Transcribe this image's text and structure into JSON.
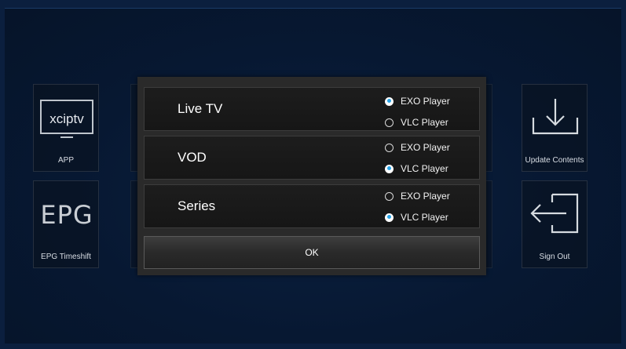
{
  "tiles": {
    "app": {
      "label": "APP",
      "logo_text": "xciptv",
      "icon": "tv-icon"
    },
    "epg": {
      "label": "EPG Timeshift",
      "logo_text": "EPG"
    },
    "update": {
      "label": "Update Contents",
      "icon": "download-icon"
    },
    "signout": {
      "label": "Sign Out",
      "icon": "sign-out-icon"
    }
  },
  "dialog": {
    "rows": [
      {
        "title": "Live TV",
        "options": [
          {
            "label": "EXO Player",
            "selected": true
          },
          {
            "label": "VLC Player",
            "selected": false
          }
        ]
      },
      {
        "title": "VOD",
        "options": [
          {
            "label": "EXO Player",
            "selected": false
          },
          {
            "label": "VLC Player",
            "selected": true
          }
        ]
      },
      {
        "title": "Series",
        "options": [
          {
            "label": "EXO Player",
            "selected": false
          },
          {
            "label": "VLC Player",
            "selected": true
          }
        ]
      }
    ],
    "ok_label": "OK"
  },
  "colors": {
    "accent": "#28a4e8",
    "background": "#071832",
    "dialog": "#2a2a2a"
  }
}
